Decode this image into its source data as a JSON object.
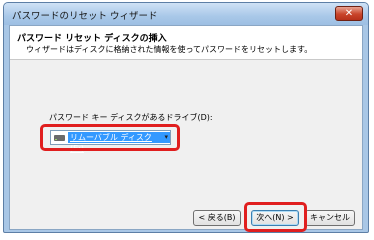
{
  "window": {
    "title": "パスワードのリセット ウィザード",
    "close_glyph": "✕"
  },
  "header": {
    "title": "パスワード リセット ディスクの挿入",
    "subtitle": "ウィザードはディスクに格納された情報を使ってパスワードをリセットします。"
  },
  "drive": {
    "label": "パスワード キー ディスクがあるドライブ(D):",
    "selected": "リムーバブル ディスク (E:)",
    "icon": "removable-drive-icon",
    "arrow_glyph": "▾"
  },
  "buttons": {
    "back": "< 戻る(B)",
    "next": "次へ(N) >",
    "cancel": "キャンセル"
  },
  "colors": {
    "highlight": "#e01e1e",
    "selection": "#3399ff",
    "titlebar": "#a9c7e6"
  }
}
